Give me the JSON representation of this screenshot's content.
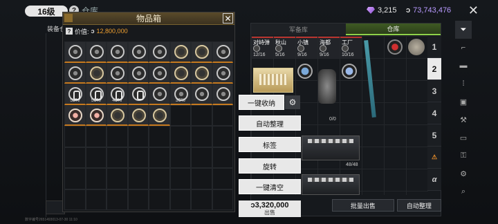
{
  "topbar": {
    "level": "16级",
    "title": "仓库",
    "gems": "3,215",
    "coins": "73,743,476"
  },
  "left": {
    "label": "装备仓",
    "footer_id": "数字编号2651493013-07-30 11:10"
  },
  "itembox": {
    "title": "物品箱",
    "value_label": "价值:",
    "value_amount": "12,800,000",
    "rows": [
      [
        {
          "t": "disc"
        },
        {
          "t": "disc"
        },
        {
          "t": "disc"
        },
        {
          "t": "disc"
        },
        {
          "t": "disc"
        },
        {
          "t": "ring"
        },
        {
          "t": "ring"
        },
        {
          "t": "disc"
        }
      ],
      [
        {
          "t": "disc"
        },
        {
          "t": "ring"
        },
        {
          "t": "disc"
        },
        {
          "t": "disc"
        },
        {
          "t": "disc"
        },
        {
          "t": "ring"
        },
        {
          "t": "ring"
        },
        {
          "t": "disc"
        }
      ],
      [
        {
          "t": "pill",
          "p": "52%"
        },
        {
          "t": "pill",
          "p": "50%"
        },
        {
          "t": "pill",
          "p": "43%"
        },
        {
          "t": "pill"
        },
        {
          "t": "disc"
        },
        {
          "t": "disc",
          "p": "36%"
        },
        {
          "t": "disc"
        },
        {
          "t": "disc"
        }
      ],
      [
        {
          "t": "pale"
        },
        {
          "t": "pale"
        },
        {
          "t": "ring"
        },
        {
          "t": "ring"
        },
        {
          "t": "ring"
        }
      ]
    ]
  },
  "warehouse": {
    "tabs": [
      "军备库",
      "仓库"
    ],
    "active_tab": 1,
    "ammo_tags": [
      {
        "name": "对峙弹",
        "count": "12/16"
      },
      {
        "name": "秋山",
        "count": "5/16"
      },
      {
        "name": "小镇",
        "count": "9/16"
      },
      {
        "name": "海都",
        "count": "9/16"
      },
      {
        "name": "工厂",
        "count": "10/16"
      }
    ],
    "armor_count": "0/0",
    "case_count": "48/48",
    "pages": [
      "1",
      "2",
      "3",
      "4",
      "5"
    ],
    "active_page": "2",
    "footer": {
      "batch_sell": "批量出售",
      "auto_sort": "自动整理"
    }
  },
  "context_menu": {
    "quick_store": "一键收纳",
    "auto_sort": "自动整理",
    "tag": "标签",
    "rotate": "旋转",
    "clear_all": "一键清空",
    "sell_value": "3,320,000",
    "sell_label": "出售"
  },
  "colors": {
    "accent_orange": "#c77a1e",
    "active_green": "#8fd24a",
    "value_orange": "#f0a030"
  }
}
